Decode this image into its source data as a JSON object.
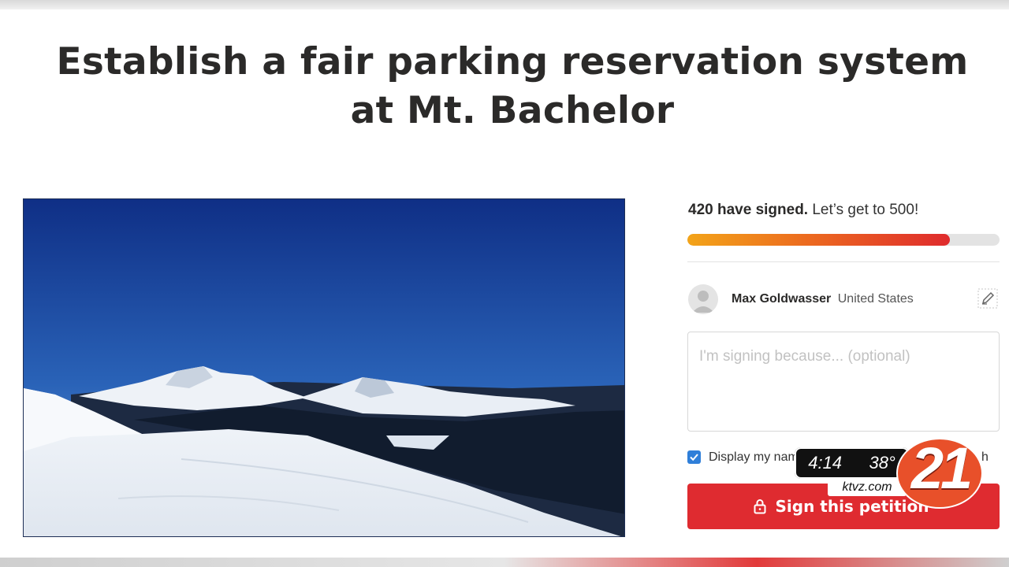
{
  "petition": {
    "title": "Establish a fair parking reservation system at Mt. Bachelor"
  },
  "progress": {
    "signed_strong": "420 have signed.",
    "goal_text": "Let’s get to 500!",
    "fraction": 0.84
  },
  "signer": {
    "name": "Max Goldwasser",
    "country": "United States"
  },
  "reason": {
    "placeholder": "I'm signing because... (optional)"
  },
  "display_name": {
    "label": "Display my name",
    "tail": "h",
    "checked": true
  },
  "sign_button": {
    "label": "Sign this petition"
  },
  "tv_overlay": {
    "time": "4:14",
    "temp": "38°",
    "url": "ktvz.com",
    "channel": "21"
  },
  "colors": {
    "button": "#df2b30",
    "checkbox": "#2f7fd9",
    "progress_start": "#f3a419",
    "progress_end": "#df2b2d"
  },
  "icons": {
    "edit": "pencil-icon",
    "lock": "lock-icon",
    "avatar": "person-icon"
  }
}
